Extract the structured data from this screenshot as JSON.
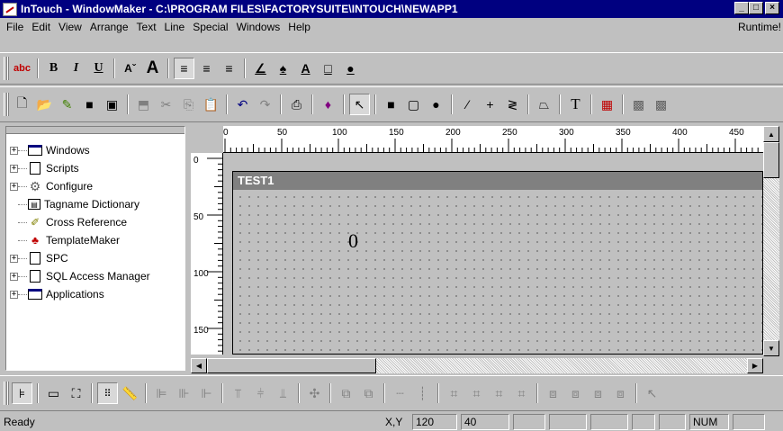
{
  "window": {
    "title": "InTouch - WindowMaker - C:\\PROGRAM FILES\\FACTORYSUITE\\INTOUCH\\NEWAPP1",
    "controls": {
      "minimize": "_",
      "maximize": "□",
      "close": "×"
    }
  },
  "menubar": {
    "items": [
      "File",
      "Edit",
      "View",
      "Arrange",
      "Text",
      "Line",
      "Special",
      "Windows",
      "Help"
    ],
    "right": "Runtime!"
  },
  "toolbar_text": {
    "buttons": [
      "spell-check",
      "B",
      "I",
      "U",
      "A-decrease",
      "A-increase",
      "align-left",
      "align-center",
      "align-right",
      "line-color",
      "fill-color",
      "text-color",
      "window-color",
      "fill-style"
    ]
  },
  "toolbar_draw": {
    "buttons": [
      "new",
      "open",
      "wizard",
      "save",
      "save-all",
      "cut",
      "copy",
      "paste",
      "paste-special",
      "undo",
      "redo",
      "print",
      "wizards",
      "select",
      "rectangle",
      "rounded-rectangle",
      "ellipse",
      "line",
      "h-v-line",
      "polyline",
      "polygon",
      "text",
      "bitmap",
      "button"
    ]
  },
  "tree": {
    "items": [
      {
        "label": "Windows",
        "icon": "window-icon",
        "expandable": true
      },
      {
        "label": "Scripts",
        "icon": "document-icon",
        "expandable": true
      },
      {
        "label": "Configure",
        "icon": "gear-icon",
        "expandable": true
      },
      {
        "label": "Tagname Dictionary",
        "icon": "dictionary-icon",
        "expandable": false
      },
      {
        "label": "Cross Reference",
        "icon": "pen-icon",
        "expandable": false
      },
      {
        "label": "TemplateMaker",
        "icon": "template-icon",
        "expandable": false
      },
      {
        "label": "SPC",
        "icon": "spc-icon",
        "expandable": true
      },
      {
        "label": "SQL Access Manager",
        "icon": "sql-icon",
        "expandable": true
      },
      {
        "label": "Applications",
        "icon": "window-icon",
        "expandable": true
      }
    ]
  },
  "ruler": {
    "top_labels": [
      "0",
      "50",
      "100",
      "150",
      "200",
      "250",
      "300",
      "350",
      "400",
      "450"
    ],
    "left_labels": [
      "0",
      "50",
      "100",
      "150"
    ]
  },
  "canvas": {
    "window_title": "TEST1",
    "value_text": "0"
  },
  "status": {
    "text": "Ready",
    "xy_label": "X,Y",
    "x": "120",
    "y": "40",
    "num": "NUM"
  }
}
